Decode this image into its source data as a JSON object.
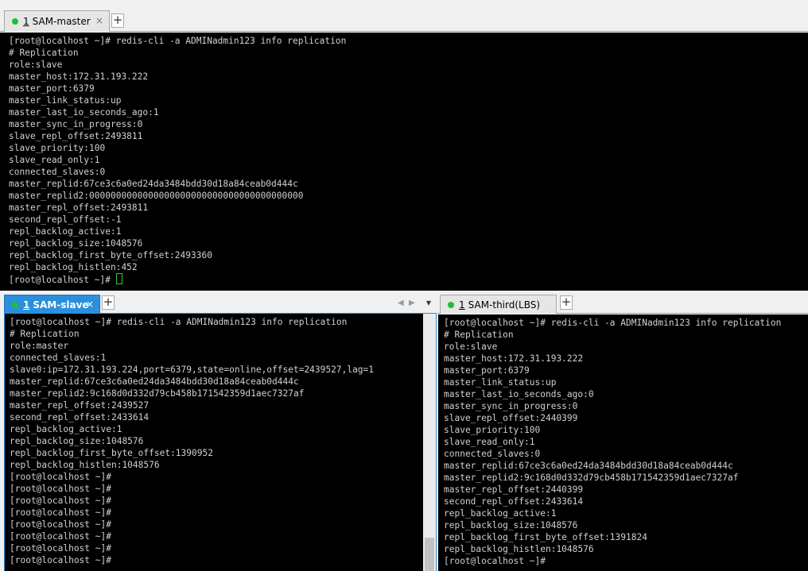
{
  "top_pane": {
    "tab": {
      "num": "1",
      "label": "SAM-master"
    },
    "lines": [
      "[root@localhost ~]# redis-cli -a ADMINadmin123 info replication",
      "# Replication",
      "role:slave",
      "master_host:172.31.193.222",
      "master_port:6379",
      "master_link_status:up",
      "master_last_io_seconds_ago:1",
      "master_sync_in_progress:0",
      "slave_repl_offset:2493811",
      "slave_priority:100",
      "slave_read_only:1",
      "connected_slaves:0",
      "master_replid:67ce3c6a0ed24da3484bdd30d18a84ceab0d444c",
      "master_replid2:0000000000000000000000000000000000000000",
      "master_repl_offset:2493811",
      "second_repl_offset:-1",
      "repl_backlog_active:1",
      "repl_backlog_size:1048576",
      "repl_backlog_first_byte_offset:2493360",
      "repl_backlog_histlen:452"
    ],
    "prompt": "[root@localhost ~]# "
  },
  "left_pane": {
    "tab": {
      "num": "1",
      "label": "SAM-slave"
    },
    "lines": [
      "[root@localhost ~]# redis-cli -a ADMINadmin123 info replication",
      "# Replication",
      "role:master",
      "connected_slaves:1",
      "slave0:ip=172.31.193.224,port=6379,state=online,offset=2439527,lag=1",
      "master_replid:67ce3c6a0ed24da3484bdd30d18a84ceab0d444c",
      "master_replid2:9c168d0d332d79cb458b171542359d1aec7327af",
      "master_repl_offset:2439527",
      "second_repl_offset:2433614",
      "repl_backlog_active:1",
      "repl_backlog_size:1048576",
      "repl_backlog_first_byte_offset:1390952",
      "repl_backlog_histlen:1048576",
      "[root@localhost ~]#",
      "[root@localhost ~]#",
      "[root@localhost ~]#",
      "[root@localhost ~]#",
      "[root@localhost ~]#",
      "[root@localhost ~]#",
      "[root@localhost ~]#",
      "[root@localhost ~]#"
    ]
  },
  "right_pane": {
    "tab": {
      "num": "1",
      "label": "SAM-third(LBS)"
    },
    "lines": [
      "[root@localhost ~]# redis-cli -a ADMINadmin123 info replication",
      "# Replication",
      "role:slave",
      "master_host:172.31.193.222",
      "master_port:6379",
      "master_link_status:up",
      "master_last_io_seconds_ago:0",
      "master_sync_in_progress:0",
      "slave_repl_offset:2440399",
      "slave_priority:100",
      "slave_read_only:1",
      "connected_slaves:0",
      "master_replid:67ce3c6a0ed24da3484bdd30d18a84ceab0d444c",
      "master_replid2:9c168d0d332d79cb458b171542359d1aec7327af",
      "master_repl_offset:2440399",
      "second_repl_offset:2433614",
      "repl_backlog_active:1",
      "repl_backlog_size:1048576",
      "repl_backlog_first_byte_offset:1391824",
      "repl_backlog_histlen:1048576",
      "[root@localhost ~]#"
    ]
  },
  "icons": {
    "close": "×",
    "add": "+",
    "prev": "◀",
    "next": "▶",
    "menu": "▾"
  }
}
